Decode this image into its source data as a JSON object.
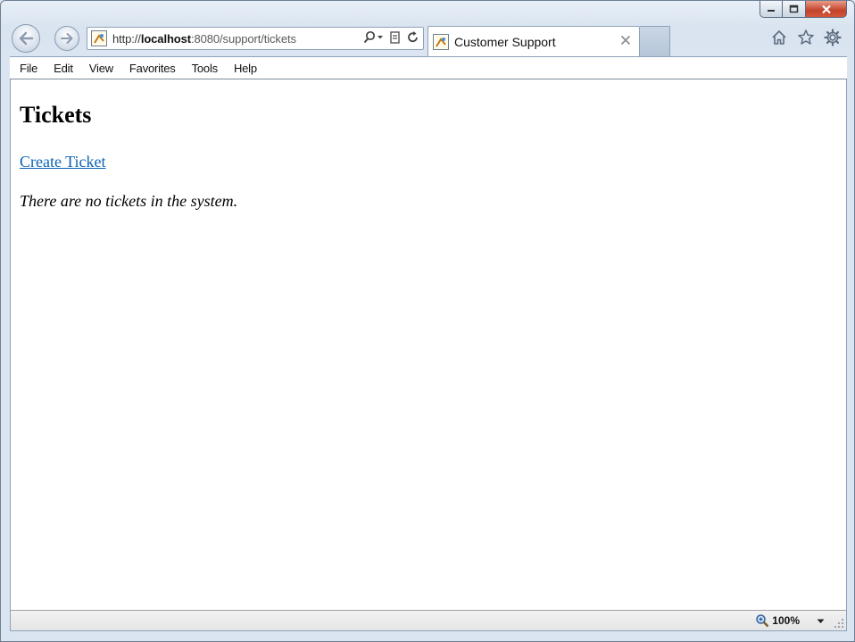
{
  "browser": {
    "url": {
      "protocol": "http://",
      "host": "localhost",
      "port": ":8080",
      "path": "/support/tickets"
    },
    "tab": {
      "title": "Customer Support"
    }
  },
  "menubar": {
    "items": [
      "File",
      "Edit",
      "View",
      "Favorites",
      "Tools",
      "Help"
    ]
  },
  "page": {
    "title": "Tickets",
    "create_link": "Create Ticket",
    "empty_message": "There are no tickets in the system."
  },
  "statusbar": {
    "zoom": "100%"
  },
  "colors": {
    "link": "#0b63b6",
    "close_button": "#c2432b"
  },
  "icons": [
    "back-arrow-icon",
    "forward-arrow-icon",
    "page-favicon",
    "search-icon",
    "compatibility-view-icon",
    "refresh-icon",
    "close-tab-icon",
    "home-icon",
    "favorites-star-icon",
    "gear-icon",
    "zoom-magnifier-icon",
    "dropdown-arrow-icon",
    "resize-grip-icon"
  ]
}
